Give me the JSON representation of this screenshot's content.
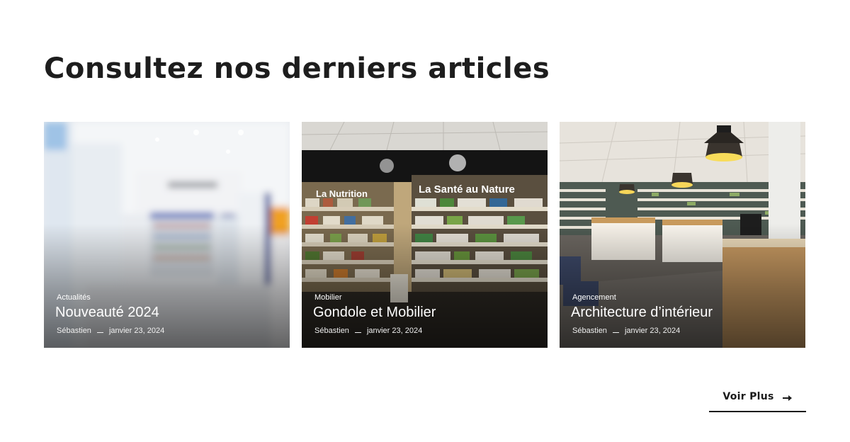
{
  "section": {
    "title": "Consultez nos derniers articles"
  },
  "articles": [
    {
      "category": "Actualités",
      "title": "Nouveauté 2024",
      "author": "Sébastien",
      "date": "janvier 23, 2024",
      "image": "blurred-pharmacy-aisle"
    },
    {
      "category": "Mobilier",
      "title": "Gondole et Mobilier",
      "author": "Sébastien",
      "date": "janvier 23, 2024",
      "image": "pharmacy-shelves-nutrition"
    },
    {
      "category": "Agencement",
      "title": "Architecture d’intérieur",
      "author": "Sébastien",
      "date": "janvier 23, 2024",
      "image": "pharmacy-interior-counters"
    }
  ],
  "more_link": {
    "label": "Voir Plus",
    "icon": "arrow-right-icon"
  },
  "colors": {
    "text": "#1b1b1b",
    "background": "#ffffff",
    "card_text": "#ffffff"
  }
}
